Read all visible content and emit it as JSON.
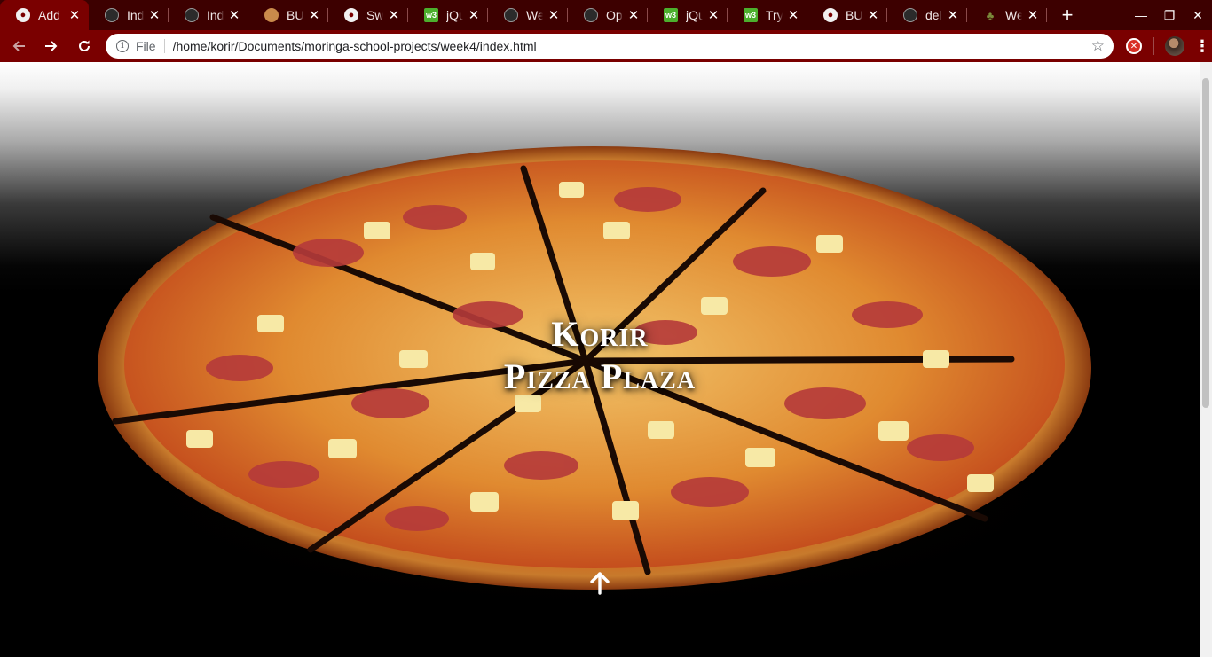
{
  "browser": {
    "tabs": [
      {
        "title": "Add",
        "favicon": "globe-icon",
        "active": true
      },
      {
        "title": "Inde",
        "favicon": "github-icon"
      },
      {
        "title": "Inde",
        "favicon": "github-icon"
      },
      {
        "title": "BUE",
        "favicon": "cookie-icon"
      },
      {
        "title": "Swe",
        "favicon": "globe-icon"
      },
      {
        "title": "jQu",
        "favicon": "w3schools-icon"
      },
      {
        "title": "Wee",
        "favicon": "github-icon"
      },
      {
        "title": "Opt",
        "favicon": "github-icon"
      },
      {
        "title": "jQu",
        "favicon": "w3schools-icon"
      },
      {
        "title": "Tryi",
        "favicon": "w3schools-icon"
      },
      {
        "title": "BUE",
        "favicon": "globe-icon"
      },
      {
        "title": "dela",
        "favicon": "github-icon"
      },
      {
        "title": "Wee",
        "favicon": "tree-icon"
      }
    ],
    "close_glyph": "✕",
    "new_tab_glyph": "+",
    "window_controls": {
      "minimize": "—",
      "restore": "❐",
      "close": "✕"
    },
    "address_bar": {
      "scheme_label": "File",
      "url": "/home/korir/Documents/moringa-school-projects/week4/index.html"
    },
    "theme_colors": {
      "tabstrip": "#3d0000",
      "toolbar": "#7a0000"
    }
  },
  "page": {
    "title_line1": "Korir",
    "title_line2": "Pizza Plaza",
    "scroll_icon": "arrow-up-icon"
  }
}
